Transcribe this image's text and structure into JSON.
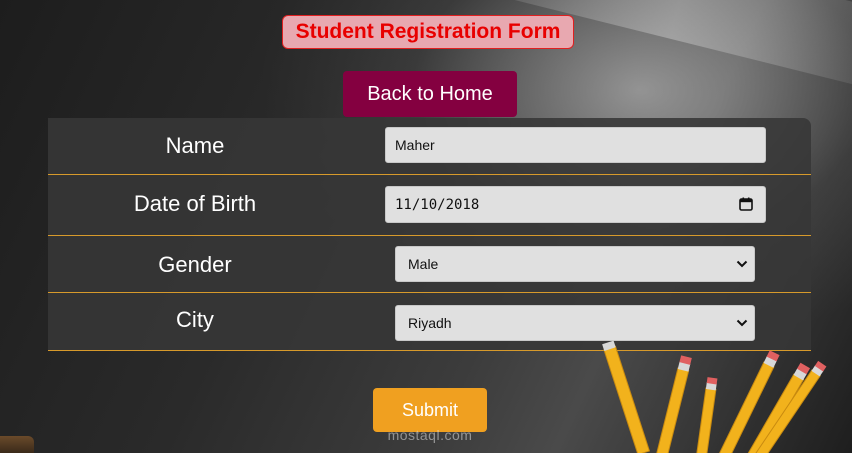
{
  "header": {
    "title": "Student Registration Form",
    "home_button": "Back to Home"
  },
  "form": {
    "fields": [
      {
        "label": "Name",
        "value": "Maher",
        "type": "text"
      },
      {
        "label": "Date of Birth",
        "value": "11/10/2018",
        "type": "date"
      },
      {
        "label": "Gender",
        "value": "Male",
        "type": "select"
      },
      {
        "label": "City",
        "value": "Riyadh",
        "type": "select"
      }
    ],
    "submit_label": "Submit"
  },
  "watermark": "mostaql.com",
  "colors": {
    "title_text": "#e80000",
    "title_bg": "#e8a8b0",
    "home_button_bg": "#840040",
    "submit_bg": "#f0a020",
    "row_divider": "#d79a2b"
  },
  "icons": {
    "date_picker": "calendar-icon",
    "select_arrow": "chevron-down-icon"
  }
}
